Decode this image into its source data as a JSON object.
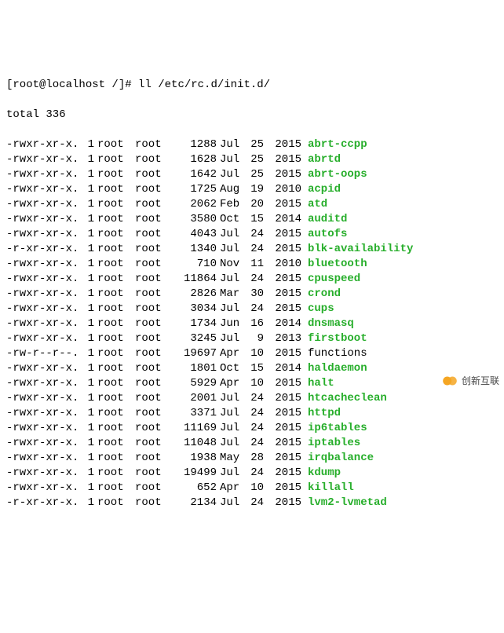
{
  "prompt": {
    "user_host": "[root@localhost /]#",
    "command": "ll /etc/rc.d/init.d/"
  },
  "total_line": "total 336",
  "rows": [
    {
      "perm": "-rwxr-xr-x.",
      "links": "1",
      "owner": "root",
      "group": "root",
      "size": "1288",
      "month": "Jul",
      "day": "25",
      "year": "2015",
      "name": "abrt-ccpp",
      "cls": "exec"
    },
    {
      "perm": "-rwxr-xr-x.",
      "links": "1",
      "owner": "root",
      "group": "root",
      "size": "1628",
      "month": "Jul",
      "day": "25",
      "year": "2015",
      "name": "abrtd",
      "cls": "exec"
    },
    {
      "perm": "-rwxr-xr-x.",
      "links": "1",
      "owner": "root",
      "group": "root",
      "size": "1642",
      "month": "Jul",
      "day": "25",
      "year": "2015",
      "name": "abrt-oops",
      "cls": "exec"
    },
    {
      "perm": "-rwxr-xr-x.",
      "links": "1",
      "owner": "root",
      "group": "root",
      "size": "1725",
      "month": "Aug",
      "day": "19",
      "year": "2010",
      "name": "acpid",
      "cls": "exec"
    },
    {
      "perm": "-rwxr-xr-x.",
      "links": "1",
      "owner": "root",
      "group": "root",
      "size": "2062",
      "month": "Feb",
      "day": "20",
      "year": "2015",
      "name": "atd",
      "cls": "exec"
    },
    {
      "perm": "-rwxr-xr-x.",
      "links": "1",
      "owner": "root",
      "group": "root",
      "size": "3580",
      "month": "Oct",
      "day": "15",
      "year": "2014",
      "name": "auditd",
      "cls": "exec"
    },
    {
      "perm": "-rwxr-xr-x.",
      "links": "1",
      "owner": "root",
      "group": "root",
      "size": "4043",
      "month": "Jul",
      "day": "24",
      "year": "2015",
      "name": "autofs",
      "cls": "exec"
    },
    {
      "perm": "-r-xr-xr-x.",
      "links": "1",
      "owner": "root",
      "group": "root",
      "size": "1340",
      "month": "Jul",
      "day": "24",
      "year": "2015",
      "name": "blk-availability",
      "cls": "exec"
    },
    {
      "perm": "-rwxr-xr-x.",
      "links": "1",
      "owner": "root",
      "group": "root",
      "size": "710",
      "month": "Nov",
      "day": "11",
      "year": "2010",
      "name": "bluetooth",
      "cls": "exec"
    },
    {
      "perm": "-rwxr-xr-x.",
      "links": "1",
      "owner": "root",
      "group": "root",
      "size": "11864",
      "month": "Jul",
      "day": "24",
      "year": "2015",
      "name": "cpuspeed",
      "cls": "exec"
    },
    {
      "perm": "-rwxr-xr-x.",
      "links": "1",
      "owner": "root",
      "group": "root",
      "size": "2826",
      "month": "Mar",
      "day": "30",
      "year": "2015",
      "name": "crond",
      "cls": "exec"
    },
    {
      "perm": "-rwxr-xr-x.",
      "links": "1",
      "owner": "root",
      "group": "root",
      "size": "3034",
      "month": "Jul",
      "day": "24",
      "year": "2015",
      "name": "cups",
      "cls": "exec"
    },
    {
      "perm": "-rwxr-xr-x.",
      "links": "1",
      "owner": "root",
      "group": "root",
      "size": "1734",
      "month": "Jun",
      "day": "16",
      "year": "2014",
      "name": "dnsmasq",
      "cls": "exec"
    },
    {
      "perm": "-rwxr-xr-x.",
      "links": "1",
      "owner": "root",
      "group": "root",
      "size": "3245",
      "month": "Jul",
      "day": "9",
      "year": "2013",
      "name": "firstboot",
      "cls": "exec"
    },
    {
      "perm": "-rw-r--r--.",
      "links": "1",
      "owner": "root",
      "group": "root",
      "size": "19697",
      "month": "Apr",
      "day": "10",
      "year": "2015",
      "name": "functions",
      "cls": "reg"
    },
    {
      "perm": "-rwxr-xr-x.",
      "links": "1",
      "owner": "root",
      "group": "root",
      "size": "1801",
      "month": "Oct",
      "day": "15",
      "year": "2014",
      "name": "haldaemon",
      "cls": "exec"
    },
    {
      "perm": "-rwxr-xr-x.",
      "links": "1",
      "owner": "root",
      "group": "root",
      "size": "5929",
      "month": "Apr",
      "day": "10",
      "year": "2015",
      "name": "halt",
      "cls": "exec"
    },
    {
      "perm": "-rwxr-xr-x.",
      "links": "1",
      "owner": "root",
      "group": "root",
      "size": "2001",
      "month": "Jul",
      "day": "24",
      "year": "2015",
      "name": "htcacheclean",
      "cls": "exec"
    },
    {
      "perm": "-rwxr-xr-x.",
      "links": "1",
      "owner": "root",
      "group": "root",
      "size": "3371",
      "month": "Jul",
      "day": "24",
      "year": "2015",
      "name": "httpd",
      "cls": "exec"
    },
    {
      "perm": "-rwxr-xr-x.",
      "links": "1",
      "owner": "root",
      "group": "root",
      "size": "11169",
      "month": "Jul",
      "day": "24",
      "year": "2015",
      "name": "ip6tables",
      "cls": "exec"
    },
    {
      "perm": "-rwxr-xr-x.",
      "links": "1",
      "owner": "root",
      "group": "root",
      "size": "11048",
      "month": "Jul",
      "day": "24",
      "year": "2015",
      "name": "iptables",
      "cls": "exec"
    },
    {
      "perm": "-rwxr-xr-x.",
      "links": "1",
      "owner": "root",
      "group": "root",
      "size": "1938",
      "month": "May",
      "day": "28",
      "year": "2015",
      "name": "irqbalance",
      "cls": "exec"
    },
    {
      "perm": "-rwxr-xr-x.",
      "links": "1",
      "owner": "root",
      "group": "root",
      "size": "19499",
      "month": "Jul",
      "day": "24",
      "year": "2015",
      "name": "kdump",
      "cls": "exec"
    },
    {
      "perm": "-rwxr-xr-x.",
      "links": "1",
      "owner": "root",
      "group": "root",
      "size": "652",
      "month": "Apr",
      "day": "10",
      "year": "2015",
      "name": "killall",
      "cls": "exec"
    },
    {
      "perm": "-r-xr-xr-x.",
      "links": "1",
      "owner": "root",
      "group": "root",
      "size": "2134",
      "month": "Jul",
      "day": "24",
      "year": "2015",
      "name": "lvm2-lvmetad",
      "cls": "exec"
    }
  ],
  "watermark": {
    "text": "创新互联"
  }
}
